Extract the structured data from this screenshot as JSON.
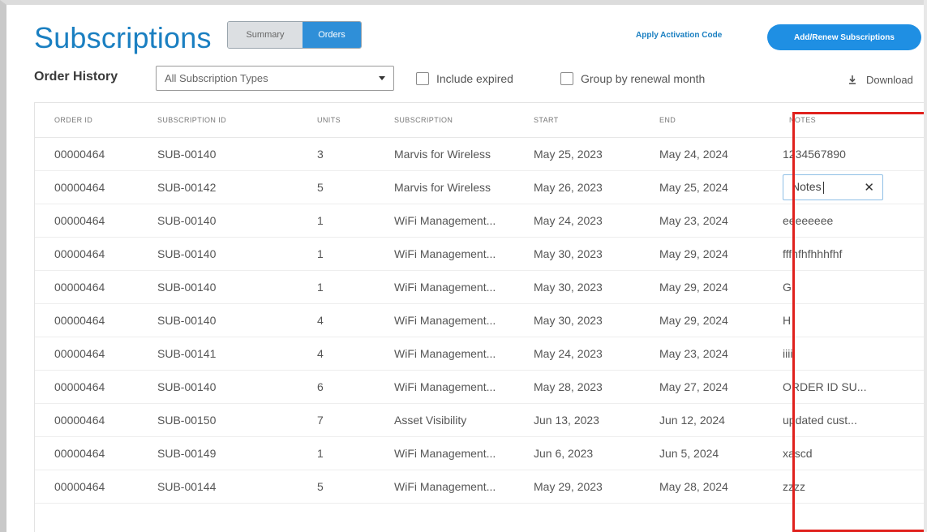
{
  "header": {
    "title": "Subscriptions",
    "segments": {
      "summary": "Summary",
      "orders": "Orders"
    },
    "apply_link": "Apply Activation Code",
    "add_button": "Add/Renew Subscriptions"
  },
  "toolbar": {
    "section_label": "Order History",
    "type_select": "All Subscription Types",
    "include_expired": "Include expired",
    "group_by_month": "Group by renewal month",
    "download": "Download"
  },
  "table": {
    "columns": [
      "ORDER ID",
      "SUBSCRIPTION ID",
      "UNITS",
      "SUBSCRIPTION",
      "START",
      "END",
      "NOTES"
    ],
    "editing_value": "Notes",
    "rows": [
      {
        "order": "00000464",
        "sub": "SUB-00140",
        "units": "3",
        "subscription": "Marvis for Wireless",
        "start": "May 25, 2023",
        "end": "May 24, 2024",
        "notes": "1234567890"
      },
      {
        "order": "00000464",
        "sub": "SUB-00142",
        "units": "5",
        "subscription": "Marvis for Wireless",
        "start": "May 26, 2023",
        "end": "May 25, 2024",
        "notes": ""
      },
      {
        "order": "00000464",
        "sub": "SUB-00140",
        "units": "1",
        "subscription": "WiFi Management...",
        "start": "May 24, 2023",
        "end": "May 23, 2024",
        "notes": "eeeeeeee"
      },
      {
        "order": "00000464",
        "sub": "SUB-00140",
        "units": "1",
        "subscription": "WiFi Management...",
        "start": "May 30, 2023",
        "end": "May 29, 2024",
        "notes": "fffhfhfhhhfhf"
      },
      {
        "order": "00000464",
        "sub": "SUB-00140",
        "units": "1",
        "subscription": "WiFi Management...",
        "start": "May 30, 2023",
        "end": "May 29, 2024",
        "notes": "G"
      },
      {
        "order": "00000464",
        "sub": "SUB-00140",
        "units": "4",
        "subscription": "WiFi Management...",
        "start": "May 30, 2023",
        "end": "May 29, 2024",
        "notes": "H"
      },
      {
        "order": "00000464",
        "sub": "SUB-00141",
        "units": "4",
        "subscription": "WiFi Management...",
        "start": "May 24, 2023",
        "end": "May 23, 2024",
        "notes": "iiii"
      },
      {
        "order": "00000464",
        "sub": "SUB-00140",
        "units": "6",
        "subscription": "WiFi Management...",
        "start": "May 28, 2023",
        "end": "May 27, 2024",
        "notes": "ORDER ID SU..."
      },
      {
        "order": "00000464",
        "sub": "SUB-00150",
        "units": "7",
        "subscription": "Asset Visibility",
        "start": "Jun 13, 2023",
        "end": "Jun 12, 2024",
        "notes": "updated cust..."
      },
      {
        "order": "00000464",
        "sub": "SUB-00149",
        "units": "1",
        "subscription": "WiFi Management...",
        "start": "Jun 6, 2023",
        "end": "Jun 5, 2024",
        "notes": "xascd"
      },
      {
        "order": "00000464",
        "sub": "SUB-00144",
        "units": "5",
        "subscription": "WiFi Management...",
        "start": "May 29, 2023",
        "end": "May 28, 2024",
        "notes": "zzzz"
      }
    ]
  },
  "colors": {
    "accent": "#1a7fc1",
    "primary_button": "#1f8fe3",
    "highlight_box": "#e0211d"
  }
}
